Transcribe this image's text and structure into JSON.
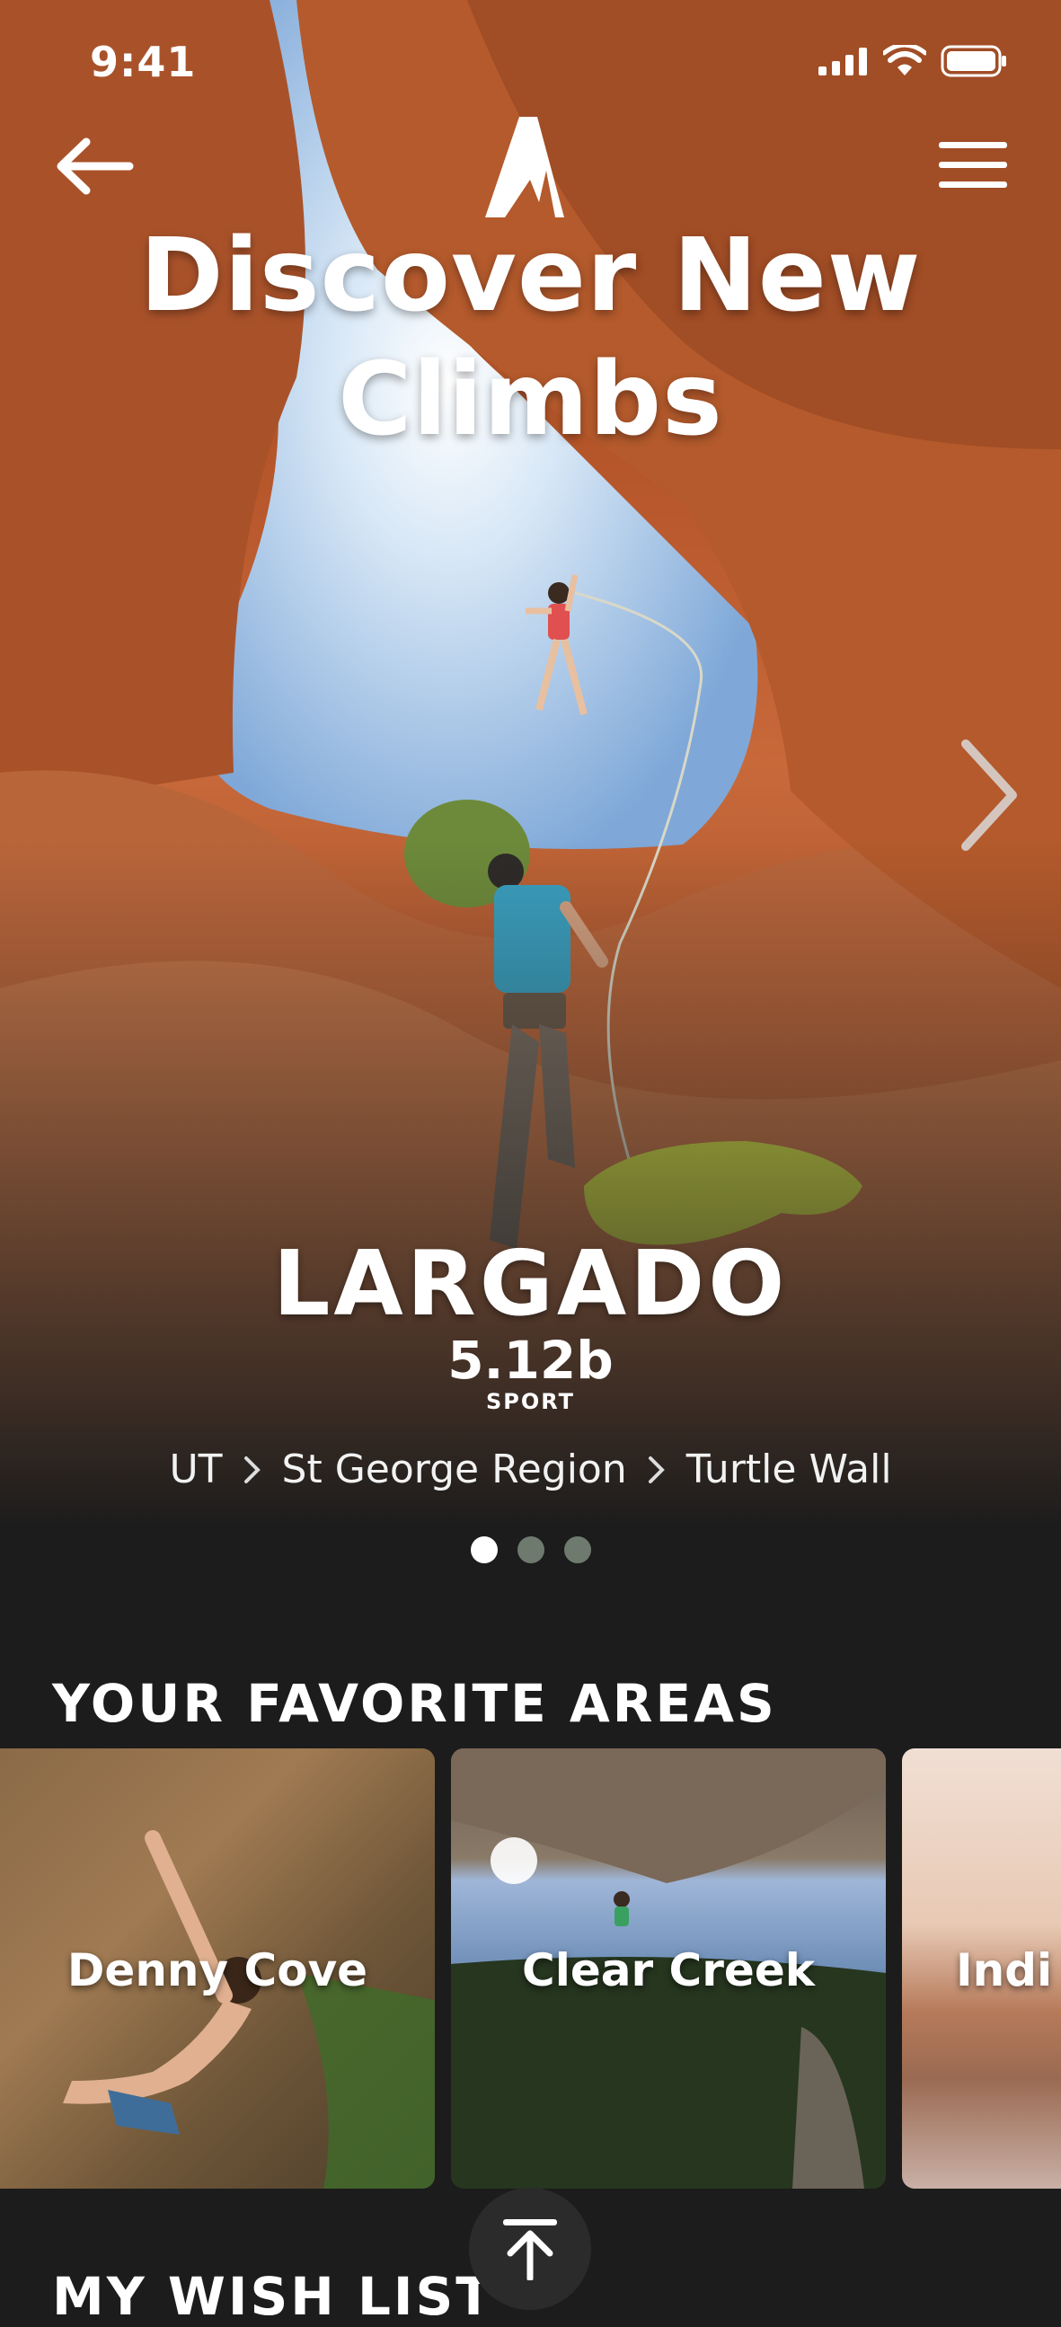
{
  "status_bar": {
    "time": "9:41"
  },
  "header": {
    "back_icon": "arrow-left-icon",
    "logo_icon": "peak-logo-icon",
    "menu_icon": "hamburger-menu-icon"
  },
  "hero": {
    "title_line1": "Discover New",
    "title_line2": "Climbs",
    "route": {
      "name": "LARGADO",
      "grade": "5.12b",
      "type": "SPORT"
    },
    "breadcrumb": [
      "UT",
      "St George Region",
      "Turtle Wall"
    ],
    "carousel": {
      "count": 3,
      "active": 1
    }
  },
  "favorites": {
    "title": "YOUR FAVORITE AREAS",
    "areas": [
      {
        "name": "Denny Cove"
      },
      {
        "name": "Clear Creek"
      },
      {
        "name": "Indi"
      }
    ]
  },
  "wishlist": {
    "title": "MY WISH LIST"
  },
  "colors": {
    "background": "#1c1c1c",
    "dot_inactive": "#6f7a6e",
    "rock": "#c8693a"
  }
}
